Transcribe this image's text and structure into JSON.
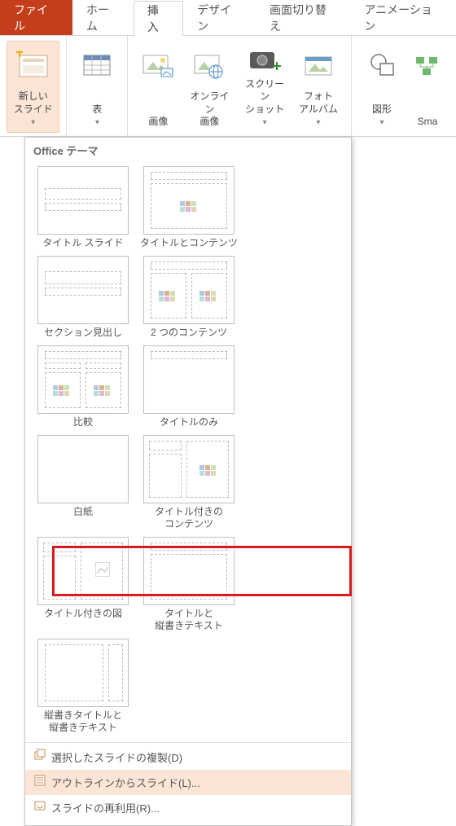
{
  "tabs": {
    "file": "ファイル",
    "home": "ホーム",
    "insert": "挿入",
    "design": "デザイン",
    "transition": "画面切り替え",
    "animation": "アニメーション"
  },
  "ribbon": {
    "newSlide": "新しい\nスライド",
    "table": "表",
    "image": "画像",
    "onlineImage": "オンライン\n画像",
    "screenshot": "スクリーン\nショット",
    "photoAlbum": "フォト\nアルバム",
    "shapes": "図形",
    "smartart": "Sma"
  },
  "dropdown": {
    "header": "Office テーマ",
    "layouts": [
      "タイトル スライド",
      "タイトルとコンテンツ",
      "セクション見出し",
      "2 つのコンテンツ",
      "比較",
      "タイトルのみ",
      "白紙",
      "タイトル付きの\nコンテンツ",
      "タイトル付きの図",
      "タイトルと\n縦書きテキスト",
      "縦書きタイトルと\n縦書きテキスト"
    ],
    "footer": {
      "duplicate": "選択したスライドの複製(D)",
      "outline": "アウトラインからスライド(L)...",
      "reuse": "スライドの再利用(R)..."
    }
  }
}
